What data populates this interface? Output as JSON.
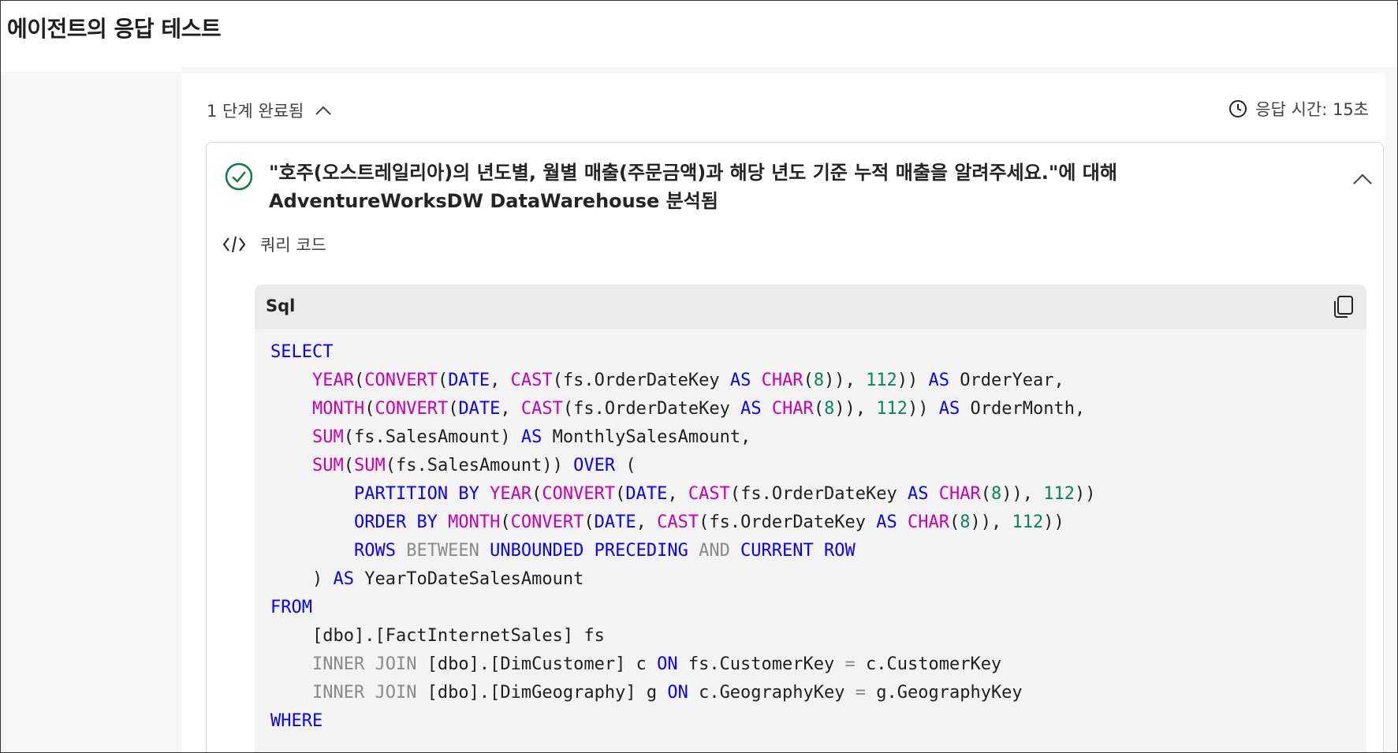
{
  "page": {
    "title": "에이전트의 응답 테스트"
  },
  "steps": {
    "label": "1 단계 완료됨",
    "toggle_icon": "chevron-up-icon"
  },
  "response_time": {
    "label": "응답 시간: 15초",
    "icon": "clock-icon"
  },
  "step_card": {
    "status_icon": "check-circle-icon",
    "status_color": "#107c41",
    "title": "\"호주(오스트레일리아)의 년도별, 월별 매출(주문금액)과 해당 년도 기준 누적 매출을 알려주세요.\"에 대해 AdventureWorksDW DataWarehouse 분석됨",
    "collapse_icon": "chevron-up-icon"
  },
  "query_code": {
    "label": "쿼리 코드",
    "icon": "code-icon"
  },
  "code_block": {
    "language": "Sql",
    "copy_icon": "copy-icon",
    "colors": {
      "keyword": "#0a00ff",
      "function": "#c800b4",
      "number": "#098658",
      "operator": "#8a8a8a"
    },
    "lines": [
      [
        [
          "kw",
          "SELECT"
        ]
      ],
      [
        [
          "",
          "    "
        ],
        [
          "fn",
          "YEAR"
        ],
        [
          "",
          "("
        ],
        [
          "fn",
          "CONVERT"
        ],
        [
          "",
          "("
        ],
        [
          "kw",
          "DATE"
        ],
        [
          "",
          ", "
        ],
        [
          "fn",
          "CAST"
        ],
        [
          "",
          "(fs.OrderDateKey "
        ],
        [
          "kw",
          "AS"
        ],
        [
          "",
          ""
        ],
        [
          "",
          ""
        ],
        [
          "fn",
          " CHAR"
        ],
        [
          "",
          "("
        ],
        [
          "num",
          "8"
        ],
        [
          "",
          "))"
        ],
        [
          "",
          ", "
        ],
        [
          "num",
          "112"
        ],
        [
          "",
          "))"
        ],
        [
          "kw",
          " AS"
        ],
        [
          "",
          " OrderYear,"
        ]
      ],
      [
        [
          "",
          "    "
        ],
        [
          "fn",
          "MONTH"
        ],
        [
          "",
          "("
        ],
        [
          "fn",
          "CONVERT"
        ],
        [
          "",
          "("
        ],
        [
          "kw",
          "DATE"
        ],
        [
          "",
          ", "
        ],
        [
          "fn",
          "CAST"
        ],
        [
          "",
          "(fs.OrderDateKey "
        ],
        [
          "kw",
          "AS"
        ],
        [
          "fn",
          " CHAR"
        ],
        [
          "",
          "("
        ],
        [
          "num",
          "8"
        ],
        [
          "",
          "))"
        ],
        [
          "",
          ", "
        ],
        [
          "num",
          "112"
        ],
        [
          "",
          "))"
        ],
        [
          "kw",
          " AS"
        ],
        [
          "",
          " OrderMonth,"
        ]
      ],
      [
        [
          "",
          "    "
        ],
        [
          "fn",
          "SUM"
        ],
        [
          "",
          "(fs.SalesAmount) "
        ],
        [
          "kw",
          "AS"
        ],
        [
          "",
          " MonthlySalesAmount,"
        ]
      ],
      [
        [
          "",
          "    "
        ],
        [
          "fn",
          "SUM"
        ],
        [
          "",
          "("
        ],
        [
          "fn",
          "SUM"
        ],
        [
          "",
          "(fs.SalesAmount)) "
        ],
        [
          "kw",
          "OVER"
        ],
        [
          "",
          " ("
        ]
      ],
      [
        [
          "",
          "        "
        ],
        [
          "kw",
          "PARTITION BY"
        ],
        [
          "fn",
          " YEAR"
        ],
        [
          "",
          "("
        ],
        [
          "fn",
          "CONVERT"
        ],
        [
          "",
          "("
        ],
        [
          "kw",
          "DATE"
        ],
        [
          "",
          ", "
        ],
        [
          "fn",
          "CAST"
        ],
        [
          "",
          "(fs.OrderDateKey "
        ],
        [
          "kw",
          "AS"
        ],
        [
          "fn",
          " CHAR"
        ],
        [
          "",
          "("
        ],
        [
          "num",
          "8"
        ],
        [
          "",
          "))"
        ],
        [
          "",
          ", "
        ],
        [
          "num",
          "112"
        ],
        [
          "",
          "))"
        ]
      ],
      [
        [
          "",
          "        "
        ],
        [
          "kw",
          "ORDER BY"
        ],
        [
          "fn",
          " MONTH"
        ],
        [
          "",
          "("
        ],
        [
          "fn",
          "CONVERT"
        ],
        [
          "",
          "("
        ],
        [
          "kw",
          "DATE"
        ],
        [
          "",
          ", "
        ],
        [
          "fn",
          "CAST"
        ],
        [
          "",
          "(fs.OrderDateKey "
        ],
        [
          "kw",
          "AS"
        ],
        [
          "fn",
          " CHAR"
        ],
        [
          "",
          "("
        ],
        [
          "num",
          "8"
        ],
        [
          "",
          "))"
        ],
        [
          "",
          ", "
        ],
        [
          "num",
          "112"
        ],
        [
          "",
          "))"
        ]
      ],
      [
        [
          "",
          "        "
        ],
        [
          "kw",
          "ROWS"
        ],
        [
          "op",
          " BETWEEN"
        ],
        [
          "kw",
          " UNBOUNDED PRECEDING"
        ],
        [
          "op",
          " AND"
        ],
        [
          "kw",
          " CURRENT ROW"
        ]
      ],
      [
        [
          "",
          "    ) "
        ],
        [
          "kw",
          "AS"
        ],
        [
          "",
          " YearToDateSalesAmount"
        ]
      ],
      [
        [
          "kw",
          "FROM"
        ]
      ],
      [
        [
          "",
          "    [dbo].[FactInternetSales] fs"
        ]
      ],
      [
        [
          "",
          "    "
        ],
        [
          "op",
          "INNER JOIN"
        ],
        [
          "",
          " [dbo].[DimCustomer] c "
        ],
        [
          "kw",
          "ON"
        ],
        [
          "",
          " fs.CustomerKey "
        ],
        [
          "op",
          "="
        ],
        [
          "",
          " c.CustomerKey"
        ]
      ],
      [
        [
          "",
          "    "
        ],
        [
          "op",
          "INNER JOIN"
        ],
        [
          "",
          " [dbo].[DimGeography] g "
        ],
        [
          "kw",
          "ON"
        ],
        [
          "",
          " c.GeographyKey "
        ],
        [
          "op",
          "="
        ],
        [
          "",
          " g.GeographyKey"
        ]
      ],
      [
        [
          "kw",
          "WHERE"
        ]
      ]
    ]
  }
}
